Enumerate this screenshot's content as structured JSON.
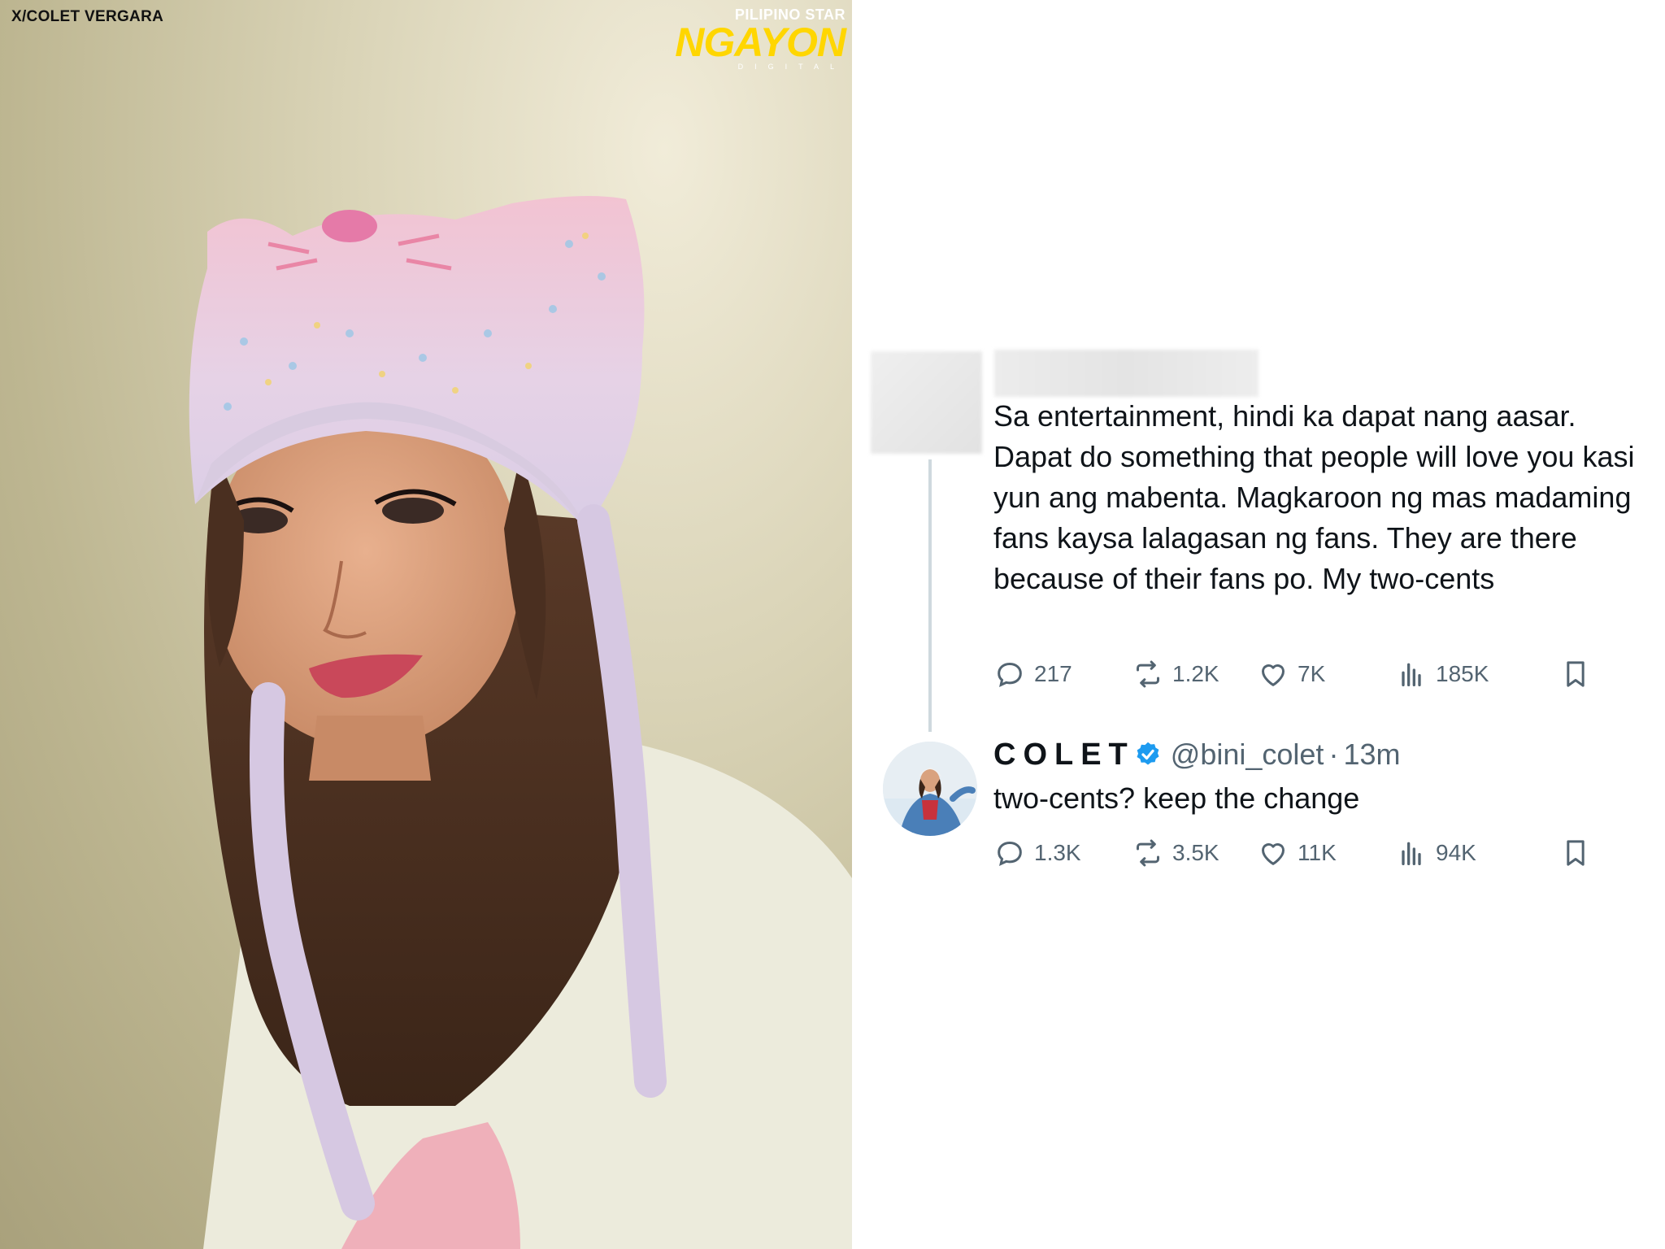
{
  "photo": {
    "credit": "X/COLET VERGARA",
    "brand": {
      "top": "PILIPINO STAR",
      "main": "NGAYON",
      "sub": "DIGITAL"
    }
  },
  "tweet1": {
    "text": "Sa entertainment, hindi ka dapat nang aasar. Dapat do something that people will love you kasi yun ang mabenta. Magkaroon ng mas madaming fans kaysa lalagasan ng fans. They are there because of their fans po. My two-cents",
    "replies": "217",
    "reposts": "1.2K",
    "likes": "7K",
    "views": "185K"
  },
  "tweet2": {
    "name": "COLET",
    "handle": "@bini_colet",
    "separator": "·",
    "time": "13m",
    "text": "two-cents? keep the change",
    "replies": "1.3K",
    "reposts": "3.5K",
    "likes": "11K",
    "views": "94K"
  },
  "colors": {
    "text": "#0f1419",
    "secondary": "#536471",
    "verified": "#1d9bf0",
    "thread_line": "#cfd9de",
    "brand_yellow": "#ffd600"
  },
  "icons": [
    "reply-icon",
    "repost-icon",
    "like-icon",
    "views-icon",
    "bookmark-icon",
    "verified-badge-icon"
  ]
}
